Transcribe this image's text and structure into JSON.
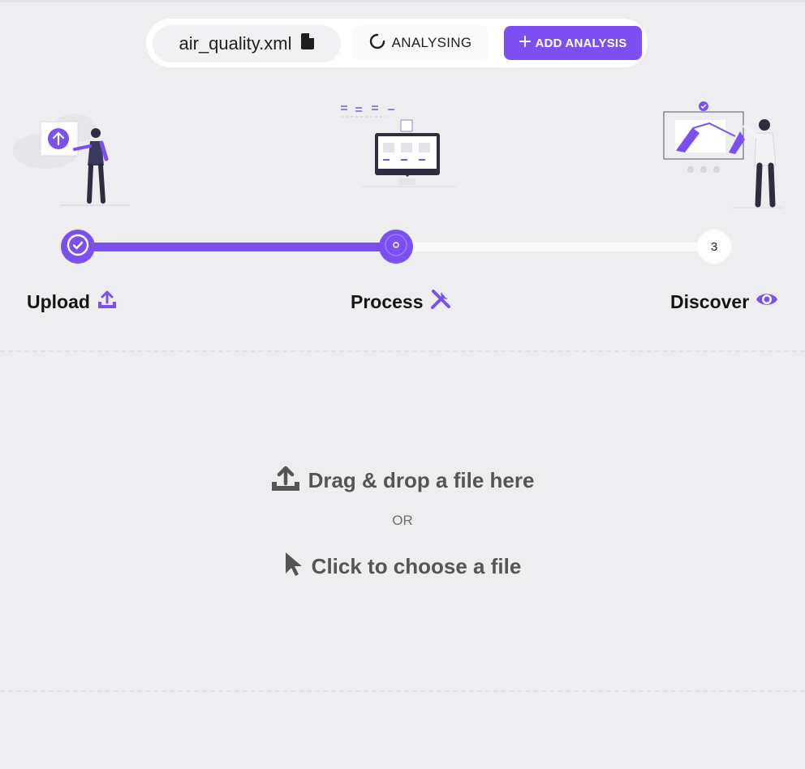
{
  "toolbar": {
    "file_name": "air_quality.xml",
    "file_icon": "file-icon",
    "status_label": "ANALYSING",
    "status_icon": "spinner-icon",
    "add_label": "ADD ANALYSIS",
    "add_icon": "plus-icon"
  },
  "stepper": {
    "progress_fraction": 0.5,
    "steps": [
      {
        "label": "Upload",
        "icon": "upload-icon",
        "state": "done"
      },
      {
        "label": "Process",
        "icon": "tools-icon",
        "state": "active"
      },
      {
        "label": "Discover",
        "icon": "eye-icon",
        "state": "pending",
        "number": "3"
      }
    ]
  },
  "dropzone": {
    "drag_label": "Drag & drop a file here",
    "or_label": "OR",
    "click_label": "Click to choose a file"
  },
  "colors": {
    "accent": "#7b4ff0",
    "background": "#eeeef1",
    "text_muted": "#555555"
  }
}
